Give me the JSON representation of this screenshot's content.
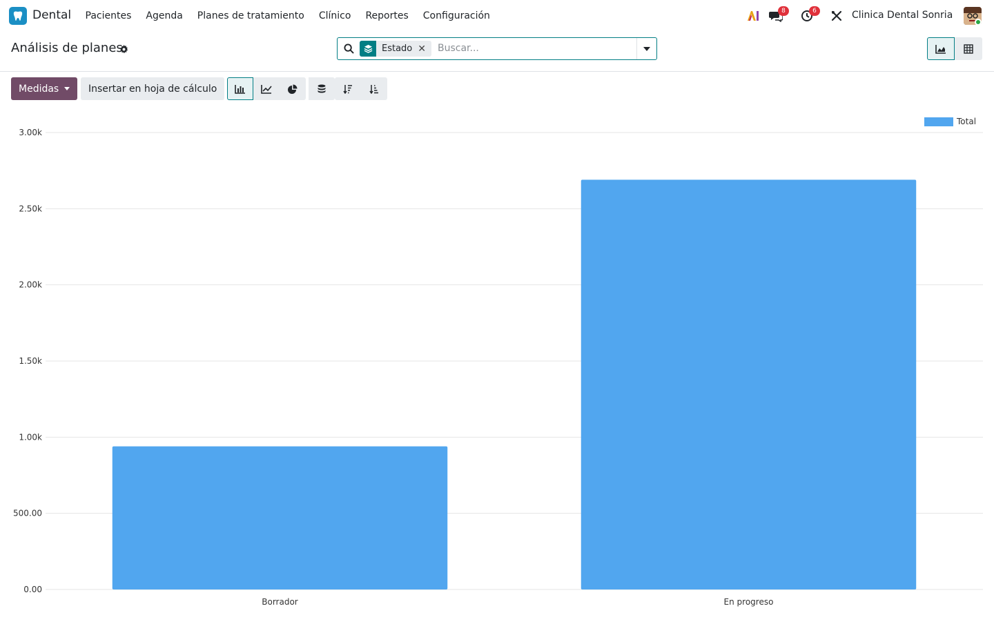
{
  "navbar": {
    "app_name": "Dental",
    "menu": [
      "Pacientes",
      "Agenda",
      "Planes de tratamiento",
      "Clínico",
      "Reportes",
      "Configuración"
    ],
    "messages_badge": "8",
    "activities_badge": "6",
    "company": "Clinica Dental Sonria"
  },
  "control_panel": {
    "title": "Análisis de planes",
    "facet_label": "Estado",
    "search_placeholder": "Buscar..."
  },
  "toolbar": {
    "measures_label": "Medidas",
    "insert_label": "Insertar en hoja de cálculo"
  },
  "colors": {
    "accent": "#017e84",
    "primary": "#714b67",
    "bar": "#51a6ef"
  },
  "chart_data": {
    "type": "bar",
    "categories": [
      "Borrador",
      "En progreso"
    ],
    "series": [
      {
        "name": "Total",
        "values": [
          940,
          2690
        ]
      }
    ],
    "ylim": [
      0,
      3000
    ],
    "yticks": [
      "0.00",
      "500.00",
      "1.00k",
      "1.50k",
      "2.00k",
      "2.50k",
      "3.00k"
    ],
    "grid": true,
    "legend": "top-right"
  }
}
